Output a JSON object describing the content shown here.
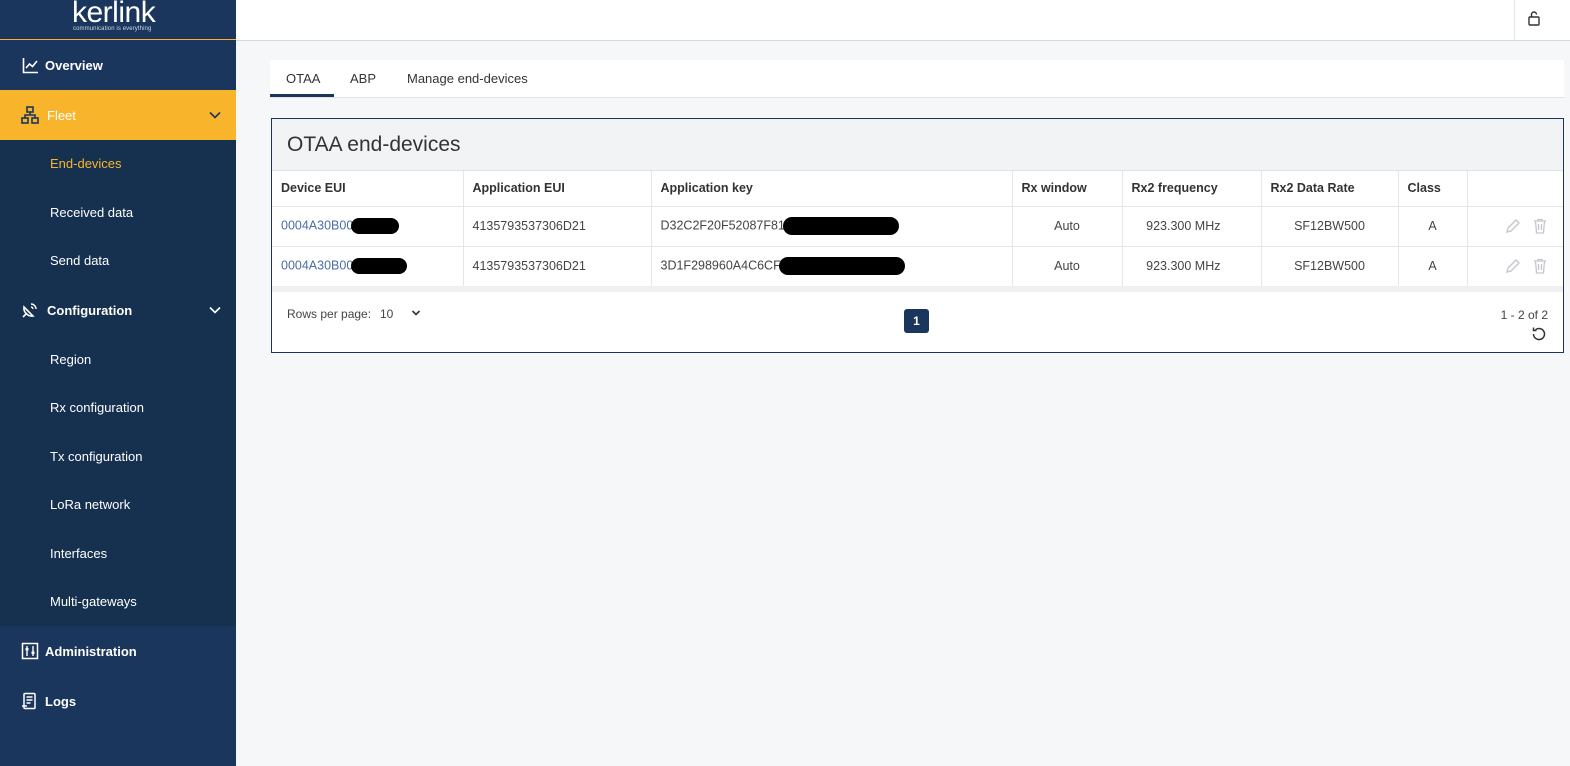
{
  "brand": {
    "name": "kerlink",
    "tagline": "communication is everything",
    "accent": "#f8b52c",
    "navy": "#1b365d"
  },
  "sidebar": {
    "overview": "Overview",
    "fleet": "Fleet",
    "fleet_items": [
      "End-devices",
      "Received data",
      "Send data"
    ],
    "configuration": "Configuration",
    "config_items": [
      "Region",
      "Rx configuration",
      "Tx configuration",
      "LoRa network",
      "Interfaces",
      "Multi-gateways"
    ],
    "administration": "Administration",
    "logs": "Logs"
  },
  "tabs": [
    "OTAA",
    "ABP",
    "Manage end-devices"
  ],
  "card": {
    "title": "OTAA end-devices",
    "columns": [
      "Device EUI",
      "Application EUI",
      "Application key",
      "Rx window",
      "Rx2 frequency",
      "Rx2 Data Rate",
      "Class"
    ],
    "rows": [
      {
        "device_eui": "0004A30B00",
        "app_eui": "4135793537306D21",
        "app_key": "D32C2F20F52087F81",
        "rx_window": "Auto",
        "rx2_freq": "923.300 MHz",
        "rx2_dr": "SF12BW500",
        "class": "A"
      },
      {
        "device_eui": "0004A30B00",
        "app_eui": "4135793537306D21",
        "app_key": "3D1F298960A4C6CF",
        "rx_window": "Auto",
        "rx2_freq": "923.300 MHz",
        "rx2_dr": "SF12BW500",
        "class": "A"
      }
    ],
    "pagination": {
      "rows_label": "Rows per page:",
      "rows_value": "10",
      "current_page": "1",
      "range": "1 - 2 of 2"
    }
  }
}
